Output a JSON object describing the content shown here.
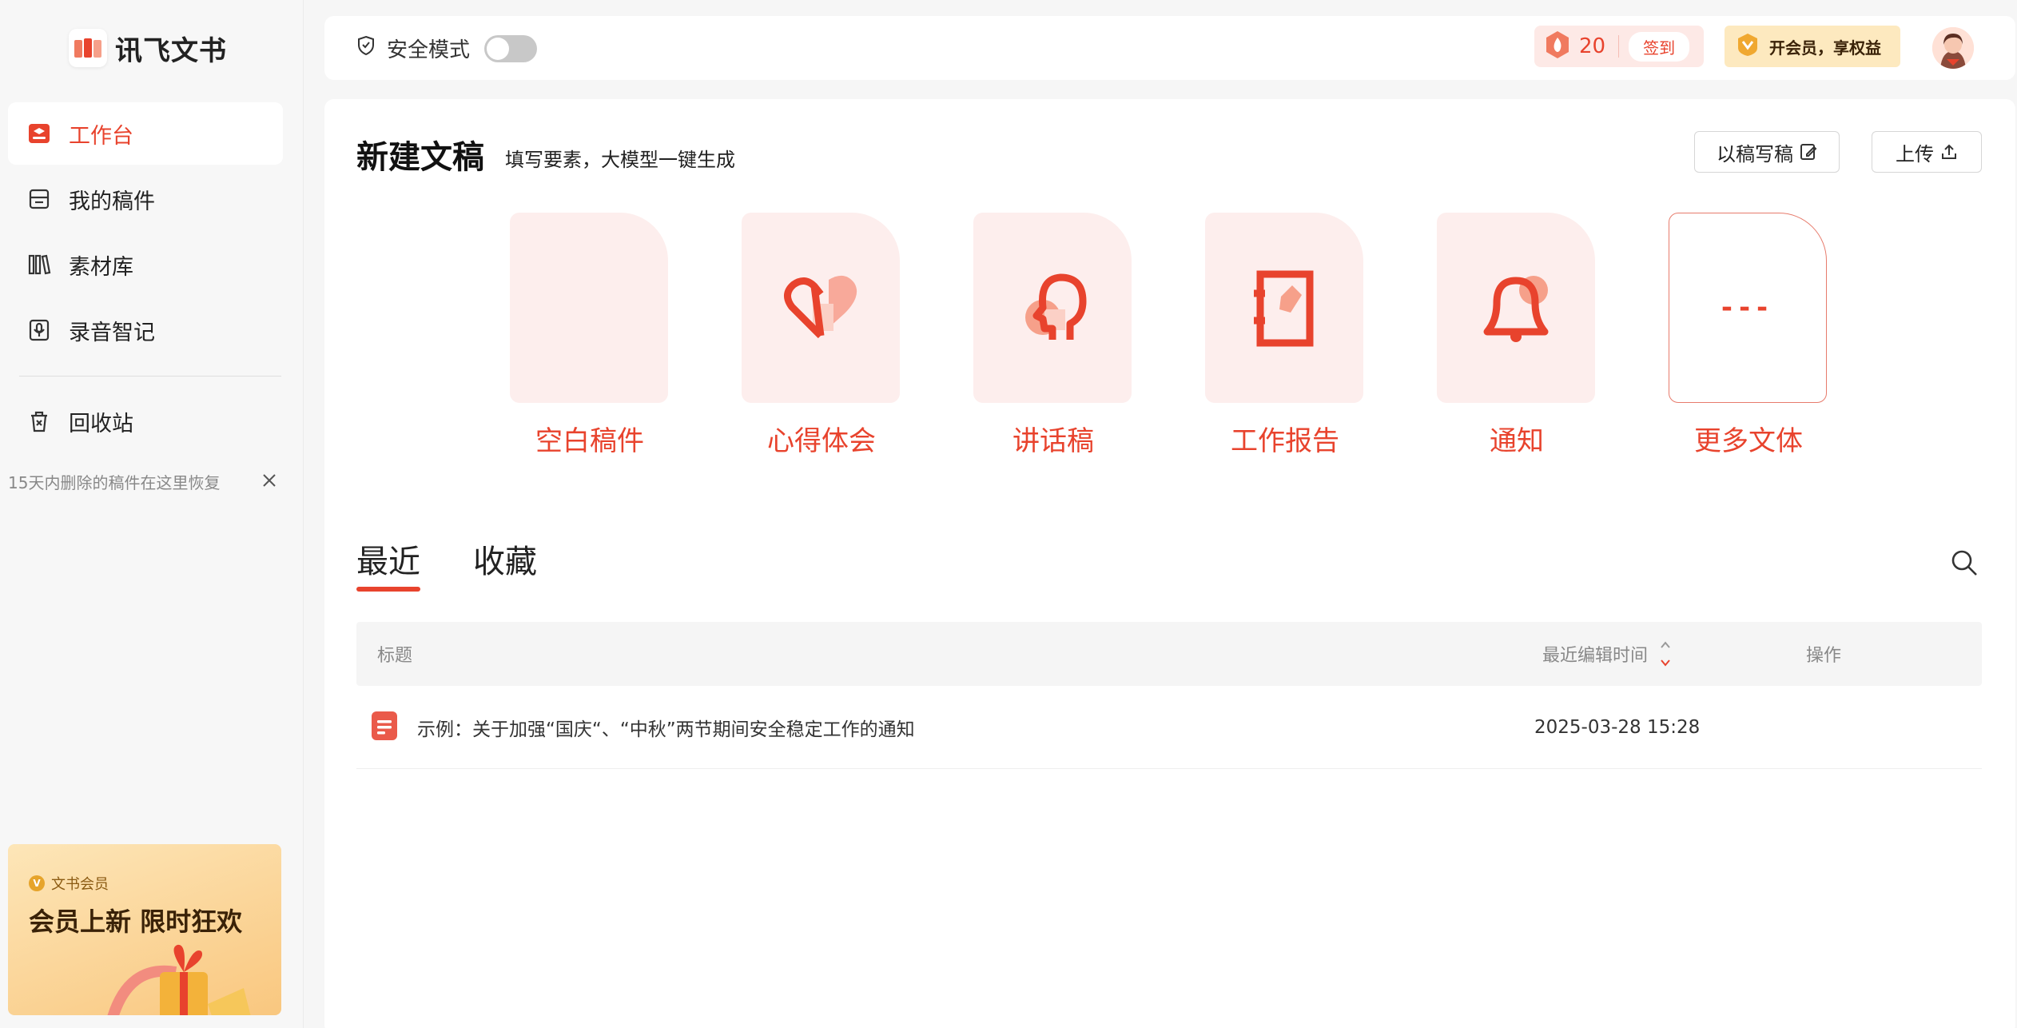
{
  "brand": {
    "name": "讯飞文书"
  },
  "sidebar": {
    "items": [
      {
        "label": "工作台",
        "icon": "workbench-icon",
        "active": true
      },
      {
        "label": "我的稿件",
        "icon": "drafts-icon",
        "active": false
      },
      {
        "label": "素材库",
        "icon": "library-icon",
        "active": false
      },
      {
        "label": "录音智记",
        "icon": "recording-icon",
        "active": false
      }
    ],
    "trash": {
      "label": "回收站",
      "icon": "trash-icon"
    },
    "trash_tip": "15天内删除的稿件在这里恢复",
    "promo": {
      "tag": "文书会员",
      "title": "会员上新 限时狂欢"
    }
  },
  "topbar": {
    "safe_mode_label": "安全模式",
    "safe_mode_on": false,
    "points": "20",
    "checkin_label": "签到",
    "vip_label": "开会员，享权益"
  },
  "main": {
    "title": "新建文稿",
    "subtitle": "填写要素，大模型一键生成",
    "btn_from_draft": "以稿写稿",
    "btn_upload": "上传",
    "templates": [
      {
        "label": "空白稿件",
        "icon": "blank-doc-icon"
      },
      {
        "label": "心得体会",
        "icon": "heart-icon"
      },
      {
        "label": "讲话稿",
        "icon": "speech-head-icon"
      },
      {
        "label": "工作报告",
        "icon": "notebook-icon"
      },
      {
        "label": "通知",
        "icon": "bell-icon"
      },
      {
        "label": "更多文体",
        "icon": "more-dashes-icon"
      }
    ],
    "tabs": [
      {
        "label": "最近",
        "active": true
      },
      {
        "label": "收藏",
        "active": false
      }
    ],
    "table": {
      "headers": {
        "title": "标题",
        "time": "最近编辑时间",
        "op": "操作"
      },
      "rows": [
        {
          "title": "示例：关于加强“国庆“、“中秋”两节期间安全稳定工作的通知",
          "time": "2025-03-28 15:28"
        }
      ]
    }
  },
  "colors": {
    "accent": "#e8432d",
    "accent_light": "#fdeeed",
    "vip": "#fde9bf"
  }
}
